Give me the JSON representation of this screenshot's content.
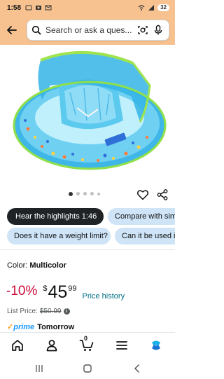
{
  "status_bar": {
    "time": "1:58",
    "battery": "32"
  },
  "search": {
    "placeholder": "Search or ask a ques..."
  },
  "product_image": {
    "description_icon": "baby-swim-float-image"
  },
  "carousel": {
    "dots": 5,
    "active_index": 0
  },
  "chips_row1": {
    "hear_highlights": "Hear the highlights 1:46",
    "compare": "Compare with simi"
  },
  "chips_row2": {
    "weight_limit": "Does it have a weight limit?",
    "used_in": "Can it be used in"
  },
  "color": {
    "label": "Color:",
    "value": "Multicolor"
  },
  "price": {
    "discount": "-10%",
    "currency": "$",
    "whole": "45",
    "fraction": "99",
    "history_link": "Price history"
  },
  "list_price": {
    "label": "List Price:",
    "value": "$50.99"
  },
  "delivery": {
    "prime": "prime",
    "text": "Tomorrow"
  },
  "cart": {
    "count": "0"
  },
  "colors": {
    "header_bg": "#f7c290",
    "discount": "#cc0c39",
    "link": "#007185",
    "chip_light": "#cfe4f7",
    "chip_dark": "#1f2326"
  }
}
